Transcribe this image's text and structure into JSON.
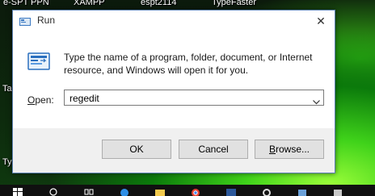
{
  "desktop": {
    "shortcuts": [
      "e-SPT PPN",
      "XAMPP",
      "espt2114",
      "TypeFaster"
    ],
    "left_labels": [
      "Ta",
      "Ty"
    ]
  },
  "dialog": {
    "title": "Run",
    "close_glyph": "✕",
    "message": "Type the name of a program, folder, document, or Internet resource, and Windows will open it for you.",
    "open_label_key": "O",
    "open_label_rest": "pen:",
    "open_value": "regedit",
    "buttons": {
      "ok": "OK",
      "cancel": "Cancel",
      "browse_key": "B",
      "browse_rest": "rowse..."
    }
  },
  "taskbar": {
    "icons": [
      "windows-icon",
      "search-icon",
      "task-view-icon",
      "edge-icon",
      "file-explorer-icon",
      "chrome-icon",
      "word-icon",
      "settings-icon",
      "network-icon",
      "app-icon"
    ]
  }
}
